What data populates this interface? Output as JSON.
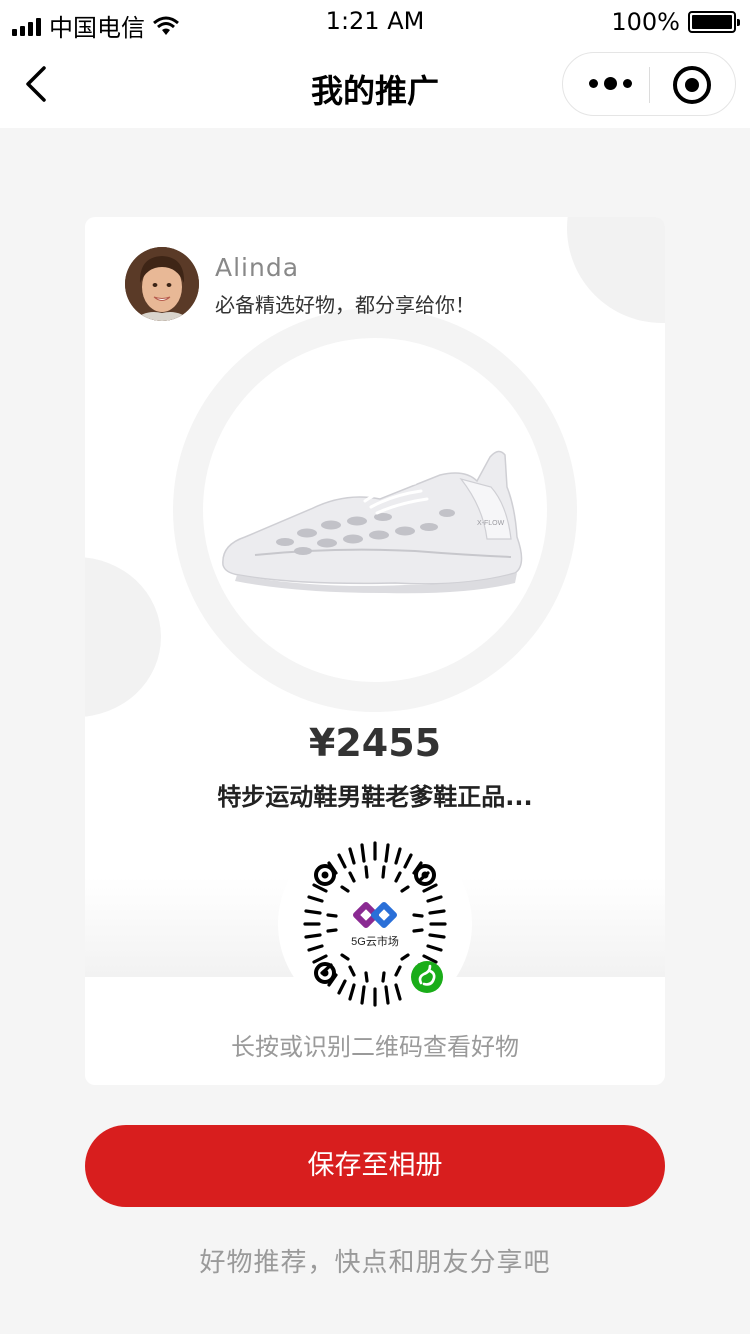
{
  "status_bar": {
    "carrier": "中国电信",
    "time": "1:21 AM",
    "battery": "100%"
  },
  "nav": {
    "title": "我的推广"
  },
  "poster": {
    "user_name": "Alinda",
    "slogan": "必备精选好物，都分享给你！",
    "price": "¥2455",
    "product_title": "特步运动鞋男鞋老爹鞋正品...",
    "shoe_brand_text": "X-FLOW",
    "qr_logo_text": "5G云市场",
    "qr_hint": "长按或识别二维码查看好物"
  },
  "actions": {
    "save_label": "保存至相册"
  },
  "footer": {
    "tip": "好物推荐，快点和朋友分享吧"
  },
  "colors": {
    "accent": "#d81e1e",
    "background": "#f5f5f5",
    "hint_text": "#9a9a9a"
  },
  "icons": [
    "back-chevron-icon",
    "more-dots-icon",
    "target-icon",
    "wifi-icon",
    "signal-icon",
    "battery-icon",
    "mini-program-icon"
  ]
}
